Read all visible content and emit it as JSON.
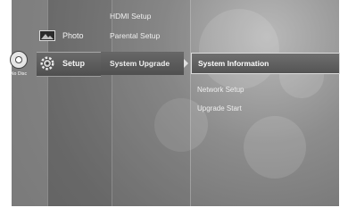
{
  "left_panel": {
    "disc_status": "No Disc",
    "disc_icon": "disc-icon"
  },
  "categories": {
    "photo": {
      "label": "Photo",
      "icon": "photo-icon"
    },
    "setup": {
      "label": "Setup",
      "icon": "gear-icon"
    }
  },
  "submenu": {
    "hdmi_setup": "HDMI Setup",
    "parental_setup": "Parental Setup",
    "system_upgrade": "System Upgrade"
  },
  "detail": {
    "system_information": "System Information",
    "network_setup": "Network Setup",
    "upgrade_start": "Upgrade Start"
  },
  "colors": {
    "background": "#7a7a7a",
    "highlight_border": "#dcdcdc",
    "text": "#ffffff"
  }
}
